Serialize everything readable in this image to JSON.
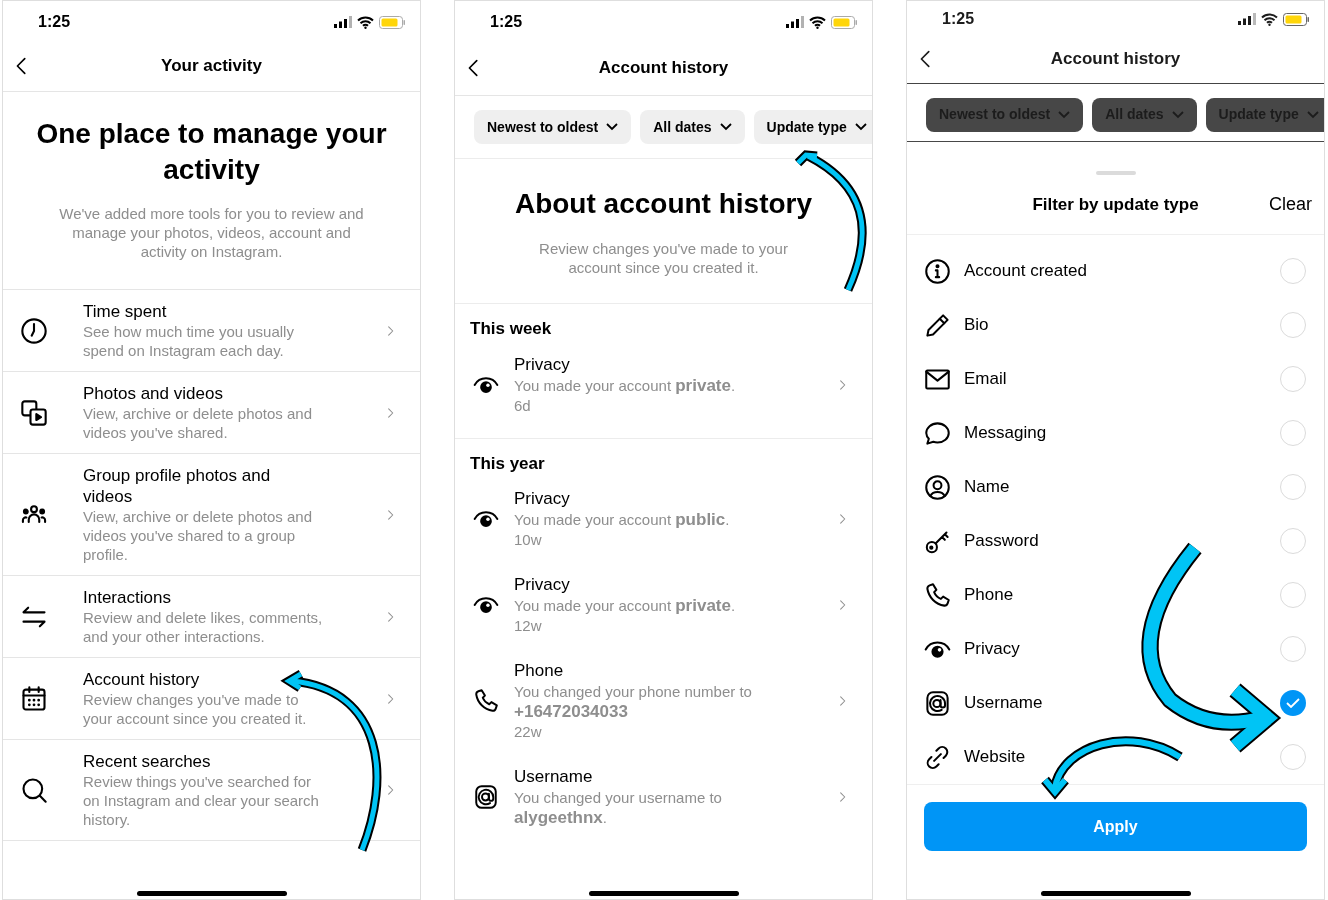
{
  "phones": [
    {
      "kind": "activity",
      "status_time": "1:25",
      "title": "Your activity",
      "hero_title": "One place to manage your activity",
      "hero_text": "We've added more tools for you to review and manage your photos, videos, account and activity on Instagram.",
      "items": [
        {
          "title": "Time spent",
          "description": "See how much time you usually spend on Instagram each day."
        },
        {
          "title": "Photos and videos",
          "description": "View, archive or delete photos and videos you've shared."
        },
        {
          "title": "Group profile photos and videos",
          "description": "View, archive or delete photos and videos you've shared to a group profile."
        },
        {
          "title": "Interactions",
          "description": "Review and delete likes, comments, and your other interactions."
        },
        {
          "title": "Account history",
          "description": "Review changes you've made to your account since you created it."
        },
        {
          "title": "Recent searches",
          "description": "Review things you've searched for on Instagram and clear your search history."
        }
      ]
    },
    {
      "kind": "history",
      "status_time": "1:25",
      "title": "Account history",
      "filters": [
        "Newest to oldest",
        "All dates",
        "Update type"
      ],
      "about_title": "About account history",
      "about_text": "Review changes you've made to your account since you created it.",
      "sections": [
        {
          "heading": "This week",
          "entries": [
            {
              "title": "Privacy",
              "description": "You made your account **private**.",
              "time": "6d"
            }
          ]
        },
        {
          "heading": "This year",
          "entries": [
            {
              "title": "Privacy",
              "description": "You made your account **public**.",
              "time": "10w"
            },
            {
              "title": "Privacy",
              "description": "You made your account **private**.",
              "time": "12w"
            },
            {
              "title": "Phone",
              "description": "You changed your phone number to **+16472034033**",
              "time": "22w"
            },
            {
              "title": "Username",
              "description": "You changed your username to **alygeethnx**."
            }
          ]
        }
      ]
    },
    {
      "kind": "filter",
      "status_time": "1:25",
      "title": "Account history",
      "filters": [
        "Newest to oldest",
        "All dates",
        "Update type"
      ],
      "sheet": {
        "title": "Filter by update type",
        "clear": "Clear",
        "apply": "Apply",
        "options": [
          {
            "label": "Account created",
            "selected": false
          },
          {
            "label": "Bio",
            "selected": false
          },
          {
            "label": "Email",
            "selected": false
          },
          {
            "label": "Messaging",
            "selected": false
          },
          {
            "label": "Name",
            "selected": false
          },
          {
            "label": "Password",
            "selected": false
          },
          {
            "label": "Phone",
            "selected": false
          },
          {
            "label": "Privacy",
            "selected": false
          },
          {
            "label": "Username",
            "selected": true
          },
          {
            "label": "Website",
            "selected": false
          }
        ]
      }
    }
  ]
}
